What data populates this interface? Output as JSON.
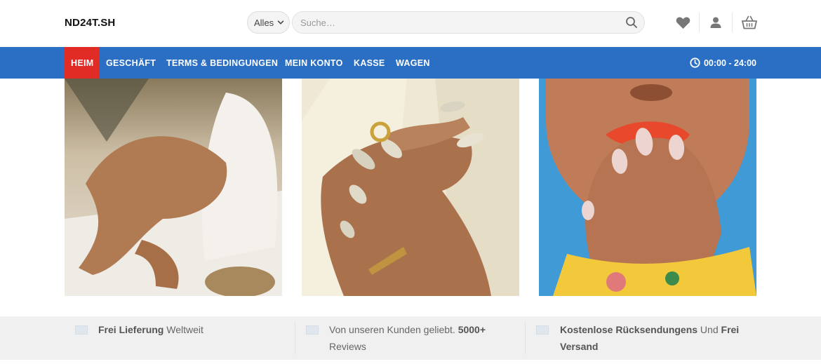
{
  "header": {
    "logo": "ND24T.SH",
    "category_select": "Alles",
    "search_placeholder": "Suche…"
  },
  "nav": {
    "items": [
      {
        "label": "HEIM",
        "active": true
      },
      {
        "label": "GESCHÄFT"
      },
      {
        "label": "TERMS & BEDINGUNGEN"
      },
      {
        "label": "MEIN KONTO"
      },
      {
        "label": "KASSE"
      },
      {
        "label": "WAGEN"
      }
    ],
    "hours": "00:00 - 24:00"
  },
  "features": [
    {
      "strong": "Frei Lieferung",
      "text": " Weltweit"
    },
    {
      "text": "Von unseren Kunden geliebt. ",
      "strong": "5000+",
      "line2": "Reviews"
    },
    {
      "strong": "Kostenlose Rücksendungens",
      "text": " Und ",
      "strong2": "Frei",
      "line2": "Versand"
    }
  ],
  "colors": {
    "nav_bg": "#2a6fc4",
    "active_bg": "#e12b25",
    "features_bg": "#f0f0f0"
  },
  "icons": [
    "chevron-down-icon",
    "search-icon",
    "heart-icon",
    "user-icon",
    "basket-icon",
    "clock-icon"
  ]
}
